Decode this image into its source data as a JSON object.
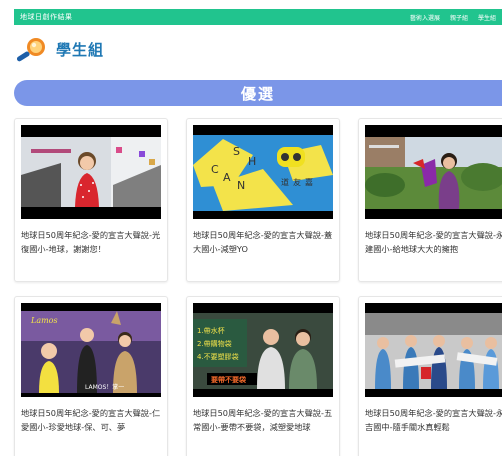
{
  "topbar": {
    "site_title": "地球日創作結果",
    "nav": [
      "藝術入選展",
      "親子組",
      "學生組"
    ]
  },
  "heading": {
    "title": "學生組"
  },
  "banner": {
    "label": "優選"
  },
  "cards": [
    {
      "caption": "地球日50周年紀念-愛的宣言大聲說-光復國小-地球，謝謝您！"
    },
    {
      "caption": "地球日50周年紀念-愛的宣言大聲說-蓋大國小-減塑YO"
    },
    {
      "caption": "地球日50周年紀念-愛的宣言大聲說-永建國小-給地球大大的擁抱"
    },
    {
      "caption": "地球日50周年紀念-愛的宣言大聲說-仁愛國小-珍愛地球-保、可、夢"
    },
    {
      "caption": "地球日50周年紀念-愛的宣言大聲說-五常國小-要帶不要袋，減塑愛地球"
    },
    {
      "caption": "地球日50周年紀念-愛的宣言大聲說-永吉國中-隨手關水真輕鬆"
    }
  ],
  "thumb_texts": {
    "card2_letters": [
      "S",
      "H",
      "C",
      "A",
      "N",
      "道",
      "友",
      "嘉"
    ],
    "card4_logo": "Lamos",
    "card4_label": "LAMOS！掌一",
    "card5_lines": [
      "1.帶水杯",
      "2.帶購物袋",
      "4.不要塑膠袋"
    ],
    "card5_banner": "要帶不要袋"
  },
  "colors": {
    "topbar": "#21c48e",
    "heading": "#1f78b4",
    "banner": "#7b96e8"
  }
}
